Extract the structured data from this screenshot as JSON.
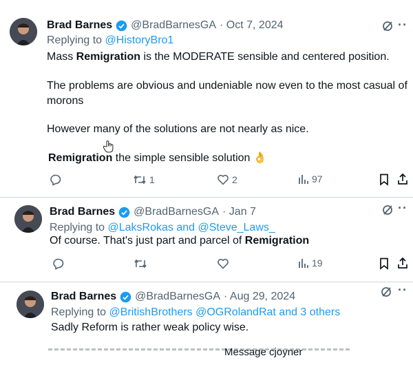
{
  "tweets": [
    {
      "name": "Brad Barnes",
      "handle": "@BradBarnesGA",
      "date": "· Oct 7, 2024",
      "replying_prefix": "Replying to ",
      "replying_to": "@HistoryBro1",
      "body": {
        "line1_pre": "Mass ",
        "line1_bold": "Remigration",
        "line1_post": " is the MODERATE sensible and centered position.",
        "line2": "The problems are obvious and undeniable now even to the most casual of",
        "line3": "morons",
        "line4": "However many of the solutions are not nearly as nice.",
        "line5_bold": "Remigration",
        "line5_post": " the simple sensible solution 👌"
      },
      "retweets": "1",
      "likes": "2",
      "views": "97"
    },
    {
      "name": "Brad Barnes",
      "handle": "@BradBarnesGA",
      "date": "· Jan 7",
      "replying_prefix": "Replying to ",
      "replying_to": "@LaksRokas and @Steve_Laws_",
      "body": {
        "line1_pre": "Of course. That's just part and parcel of ",
        "line1_bold": "Remigration"
      },
      "retweets": "",
      "likes": "",
      "views": "19"
    },
    {
      "name": "Brad Barnes",
      "handle": "@BradBarnesGA",
      "date": "· Aug 29, 2024",
      "replying_prefix": "Replying to ",
      "replying_to": "@BritishBrothers @OGRolandRat and 3 others",
      "body": {
        "line1": "Sadly Reform is rather weak policy wise."
      }
    }
  ],
  "message_bar": {
    "label": "Message cjoyner"
  },
  "colors": {
    "accent": "#1d9bf0",
    "muted": "#536471"
  }
}
